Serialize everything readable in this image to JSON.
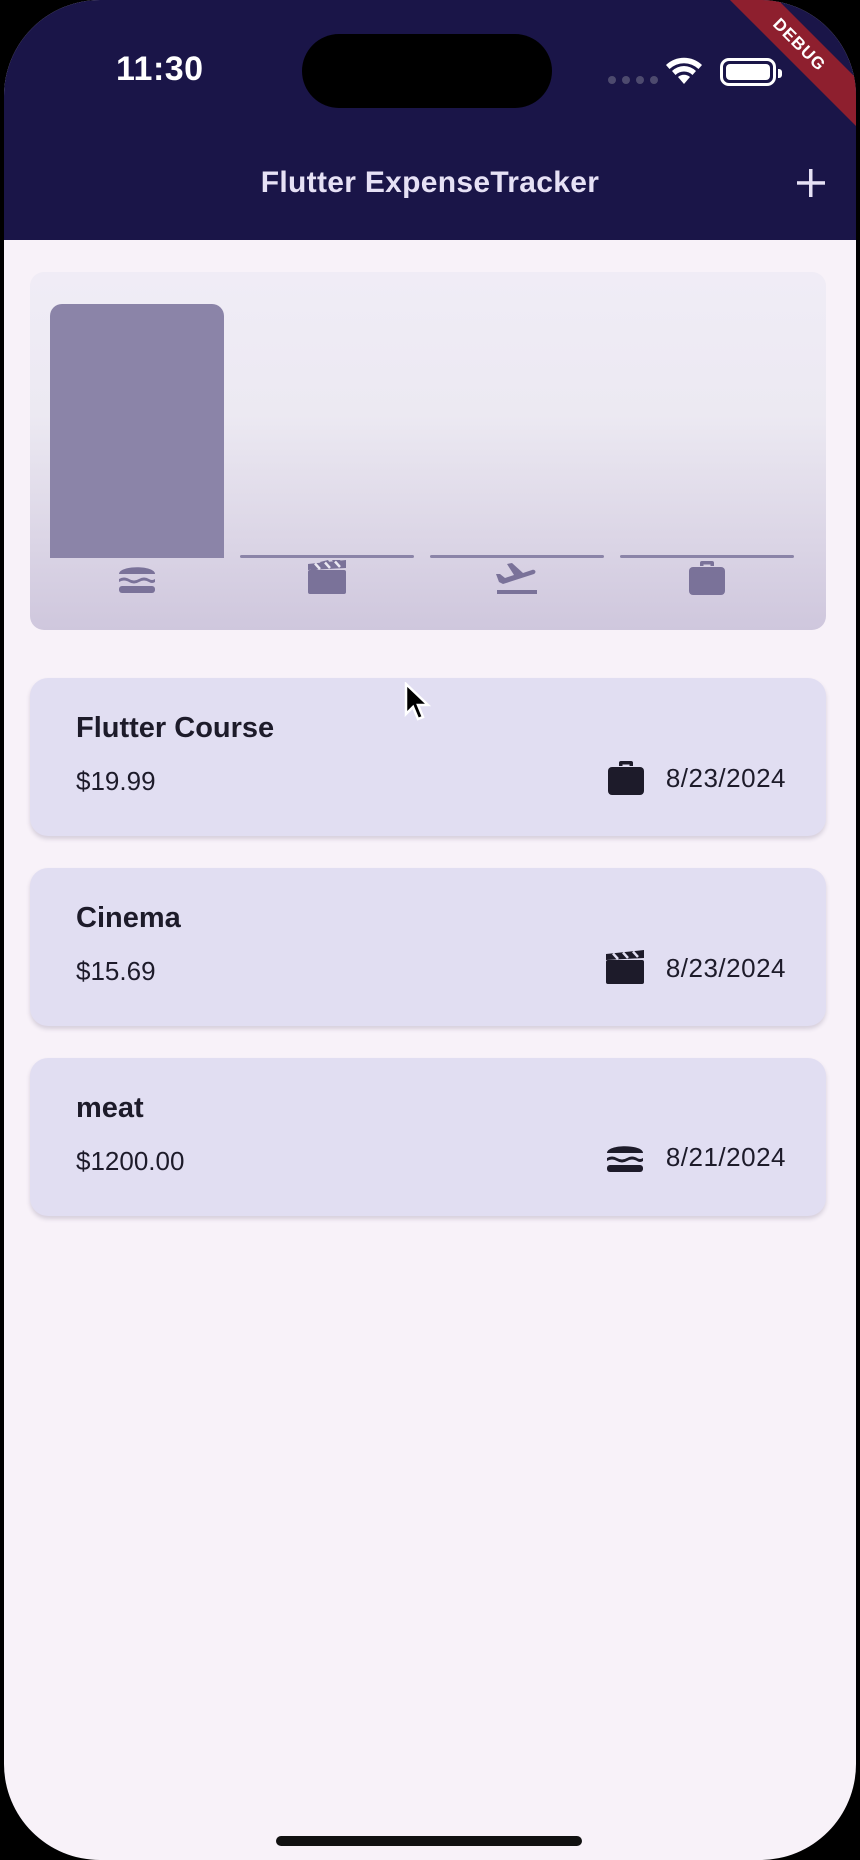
{
  "status_bar": {
    "time": "11:30"
  },
  "debug_banner": "DEBUG",
  "app_bar": {
    "title": "Flutter ExpenseTracker",
    "add_icon": "plus-icon"
  },
  "chart": {
    "bar_color": "#8b84a8",
    "categories": [
      {
        "name": "food",
        "icon": "hamburger-icon",
        "fill": 1.0
      },
      {
        "name": "leisure",
        "icon": "clapperboard-icon",
        "fill": 0.0
      },
      {
        "name": "travel",
        "icon": "airplane-departure-icon",
        "fill": 0.0
      },
      {
        "name": "work",
        "icon": "briefcase-icon",
        "fill": 0.0
      }
    ]
  },
  "expenses": [
    {
      "title": "Flutter Course",
      "amount": "$19.99",
      "category_icon": "briefcase-icon",
      "date": "8/23/2024"
    },
    {
      "title": "Cinema",
      "amount": "$15.69",
      "category_icon": "clapperboard-icon",
      "date": "8/23/2024"
    },
    {
      "title": "meat",
      "amount": "$1200.00",
      "category_icon": "hamburger-icon",
      "date": "8/21/2024"
    }
  ],
  "colors": {
    "app_bar": "#1a1548",
    "background": "#f8f2f9",
    "card": "#e1def2",
    "text": "#1d1b2a"
  }
}
